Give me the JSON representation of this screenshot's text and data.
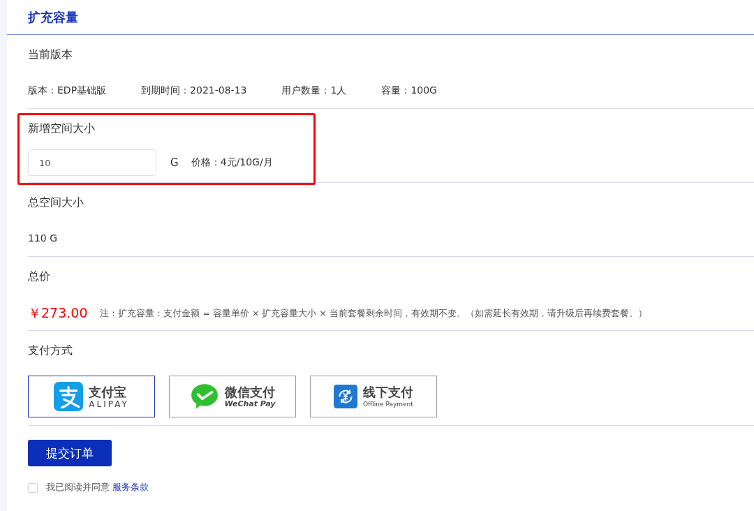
{
  "title": "扩充容量",
  "current_version": {
    "heading": "当前版本",
    "fields": [
      "版本：EDP基础版",
      "到期时间：2021-08-13",
      "用户数量：1人",
      "容量：100G"
    ]
  },
  "added_space": {
    "heading": "新增空间大小",
    "highlighted": true,
    "input_value": "10",
    "unit": "G",
    "price": "价格：4元/10G/月"
  },
  "total_space": {
    "heading": "总空间大小",
    "value": "110 G"
  },
  "total_price": {
    "heading": "总价",
    "amount": "￥273.00",
    "note": "注：扩充容量：支付金额 = 容量单价 × 扩充容量大小 × 当前套餐剩余时间，有效期不变。（如需延长有效期，请升级后再续费套餐。）"
  },
  "payment": {
    "heading": "支付方式",
    "methods": [
      {
        "kind": "alipay",
        "title": "支付宝",
        "subtitle": "ALIPAY",
        "selected": true
      },
      {
        "kind": "wechat",
        "title": "微信支付",
        "subtitle": "WeChat Pay",
        "selected": false
      },
      {
        "kind": "offline",
        "title": "线下支付",
        "subtitle": "Offline Payment",
        "selected": false
      }
    ]
  },
  "submit_button": "提交订单",
  "agreement": {
    "checked": false,
    "text": "我已阅读并同意",
    "link": "服务条款"
  }
}
